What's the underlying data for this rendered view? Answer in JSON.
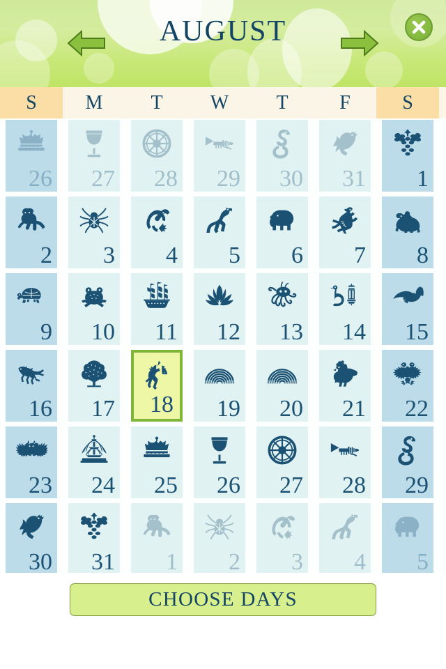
{
  "header": {
    "month_label": "AUGUST",
    "prev_icon": "left-arrow-icon",
    "next_icon": "right-arrow-icon",
    "close_icon": "close-x-icon",
    "accent_green": "#bfe465",
    "title_color": "#134463"
  },
  "weekdays": [
    {
      "label": "S",
      "weekend": true
    },
    {
      "label": "M",
      "weekend": false
    },
    {
      "label": "T",
      "weekend": false
    },
    {
      "label": "W",
      "weekend": false
    },
    {
      "label": "T",
      "weekend": false
    },
    {
      "label": "F",
      "weekend": false
    },
    {
      "label": "S",
      "weekend": true
    }
  ],
  "weekday_bg": "#fbf5e8",
  "weekend_bg": "#fbdda6",
  "cell_bg": "#e1f2f2",
  "cell_weekend_bg": "#bcdcea",
  "selected_bg": "#eef7a6",
  "selected_border": "#7fb539",
  "glyph_color": "#1b5274",
  "selected_day": 18,
  "weeks": [
    [
      {
        "day": "26",
        "icon": "crown-icon",
        "outside": true,
        "weekend": true,
        "selected": false
      },
      {
        "day": "27",
        "icon": "goblet-icon",
        "outside": true,
        "weekend": false,
        "selected": false
      },
      {
        "day": "28",
        "icon": "wheel-icon",
        "outside": true,
        "weekend": false,
        "selected": false
      },
      {
        "day": "29",
        "icon": "trumpet-icon",
        "outside": true,
        "weekend": false,
        "selected": false
      },
      {
        "day": "30",
        "icon": "snake-icon",
        "outside": true,
        "weekend": false,
        "selected": false
      },
      {
        "day": "31",
        "icon": "dove-icon",
        "outside": true,
        "weekend": false,
        "selected": false
      },
      {
        "day": "1",
        "icon": "grapes-icon",
        "outside": false,
        "weekend": true,
        "selected": false
      }
    ],
    [
      {
        "day": "2",
        "icon": "monkey-icon",
        "outside": false,
        "weekend": true,
        "selected": false
      },
      {
        "day": "3",
        "icon": "spider-icon",
        "outside": false,
        "weekend": false,
        "selected": false
      },
      {
        "day": "4",
        "icon": "eagle-icon",
        "outside": false,
        "weekend": false,
        "selected": false
      },
      {
        "day": "5",
        "icon": "horse-icon",
        "outside": false,
        "weekend": false,
        "selected": false
      },
      {
        "day": "6",
        "icon": "elephant-icon",
        "outside": false,
        "weekend": false,
        "selected": false
      },
      {
        "day": "7",
        "icon": "dragon-icon",
        "outside": false,
        "weekend": false,
        "selected": false
      },
      {
        "day": "8",
        "icon": "bear-icon",
        "outside": false,
        "weekend": true,
        "selected": false
      }
    ],
    [
      {
        "day": "9",
        "icon": "turtle-icon",
        "outside": false,
        "weekend": true,
        "selected": false
      },
      {
        "day": "10",
        "icon": "frog-icon",
        "outside": false,
        "weekend": false,
        "selected": false
      },
      {
        "day": "11",
        "icon": "ship-icon",
        "outside": false,
        "weekend": false,
        "selected": false
      },
      {
        "day": "12",
        "icon": "lotus-icon",
        "outside": false,
        "weekend": false,
        "selected": false
      },
      {
        "day": "13",
        "icon": "octopus-icon",
        "outside": false,
        "weekend": false,
        "selected": false
      },
      {
        "day": "14",
        "icon": "swan-lantern-icon",
        "outside": false,
        "weekend": false,
        "selected": false
      },
      {
        "day": "15",
        "icon": "whale-icon",
        "outside": false,
        "weekend": true,
        "selected": false
      }
    ],
    [
      {
        "day": "16",
        "icon": "cheetah-icon",
        "outside": false,
        "weekend": true,
        "selected": false
      },
      {
        "day": "17",
        "icon": "tree-icon",
        "outside": false,
        "weekend": false,
        "selected": false
      },
      {
        "day": "18",
        "icon": "unicorn-icon",
        "outside": false,
        "weekend": false,
        "selected": true
      },
      {
        "day": "19",
        "icon": "rainbow-icon",
        "outside": false,
        "weekend": false,
        "selected": false
      },
      {
        "day": "20",
        "icon": "rainbow-icon",
        "outside": false,
        "weekend": false,
        "selected": false
      },
      {
        "day": "21",
        "icon": "rooster-icon",
        "outside": false,
        "weekend": false,
        "selected": false
      },
      {
        "day": "22",
        "icon": "double-eagle-icon",
        "outside": false,
        "weekend": true,
        "selected": false
      }
    ],
    [
      {
        "day": "23",
        "icon": "bat-icon",
        "outside": false,
        "weekend": true,
        "selected": false
      },
      {
        "day": "24",
        "icon": "fountain-icon",
        "outside": false,
        "weekend": false,
        "selected": false
      },
      {
        "day": "25",
        "icon": "crown-icon",
        "outside": false,
        "weekend": false,
        "selected": false
      },
      {
        "day": "26",
        "icon": "goblet-icon",
        "outside": false,
        "weekend": false,
        "selected": false
      },
      {
        "day": "27",
        "icon": "wheel-icon",
        "outside": false,
        "weekend": false,
        "selected": false
      },
      {
        "day": "28",
        "icon": "trumpet-icon",
        "outside": false,
        "weekend": false,
        "selected": false
      },
      {
        "day": "29",
        "icon": "snake-icon",
        "outside": false,
        "weekend": true,
        "selected": false
      }
    ],
    [
      {
        "day": "30",
        "icon": "dove-icon",
        "outside": false,
        "weekend": true,
        "selected": false
      },
      {
        "day": "31",
        "icon": "grapes-icon",
        "outside": false,
        "weekend": false,
        "selected": false
      },
      {
        "day": "1",
        "icon": "monkey-icon",
        "outside": true,
        "weekend": false,
        "selected": false
      },
      {
        "day": "2",
        "icon": "spider-icon",
        "outside": true,
        "weekend": false,
        "selected": false
      },
      {
        "day": "3",
        "icon": "eagle-icon",
        "outside": true,
        "weekend": false,
        "selected": false
      },
      {
        "day": "4",
        "icon": "horse-icon",
        "outside": true,
        "weekend": false,
        "selected": false
      },
      {
        "day": "5",
        "icon": "elephant-icon",
        "outside": true,
        "weekend": true,
        "selected": false
      }
    ]
  ],
  "footer": {
    "choose_days_label": "CHOOSE DAYS"
  }
}
